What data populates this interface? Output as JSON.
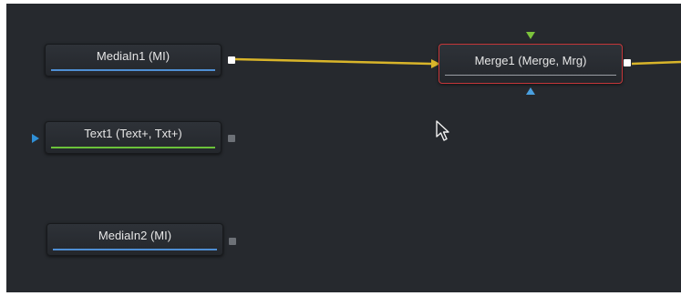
{
  "nodes": {
    "media_in_1": {
      "label": "MediaIn1  (MI)"
    },
    "text_1": {
      "label": "Text1  (Text+, Txt+)"
    },
    "media_in_2": {
      "label": "MediaIn2  (MI)"
    },
    "merge_1": {
      "label": "Merge1  (Merge, Mrg)"
    }
  },
  "colors": {
    "canvas_bg": "#26292e",
    "wire": "#d9b52a",
    "media_bar": "#4f8fd4",
    "text_bar": "#6bc23a",
    "selection": "#c5373a",
    "foreground_input": "#7cc33c",
    "mask_input": "#4aa0e0",
    "text_input": "#2f8fd6"
  },
  "icons": {
    "pointer": "arrow-cursor-icon"
  }
}
